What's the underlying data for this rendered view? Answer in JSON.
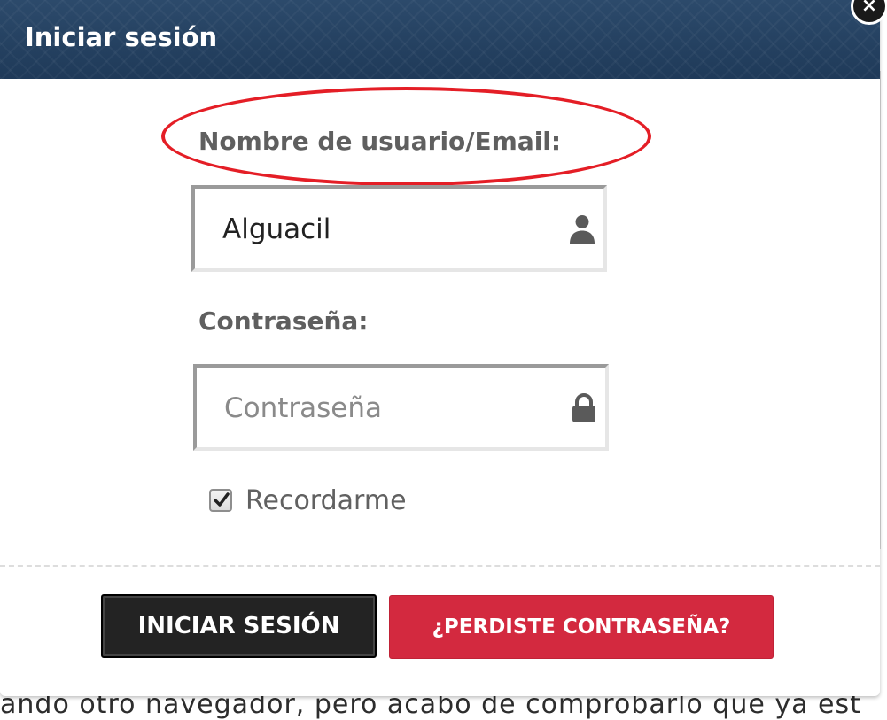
{
  "background": {
    "peek_text": "ando otro navegador, pero acabo de comprobarlo que ya est"
  },
  "modal": {
    "title": "Iniciar sesión",
    "close_label": "×"
  },
  "form": {
    "username": {
      "label": "Nombre de usuario/Email:",
      "value": "Alguacil",
      "icon": "user-icon"
    },
    "password": {
      "label": "Contraseña:",
      "placeholder": "Contraseña",
      "icon": "lock-icon"
    },
    "remember": {
      "label": "Recordarme",
      "checked": true
    }
  },
  "buttons": {
    "login_label": "INICIAR SESIÓN",
    "lost_password_label": "¿PERDISTE CONTRASEÑA?"
  },
  "colors": {
    "header": "#1f3a59",
    "login_button": "#232323",
    "lost_button": "#d3293f",
    "highlight": "#e41e26",
    "label_text": "#5f5f5f"
  }
}
